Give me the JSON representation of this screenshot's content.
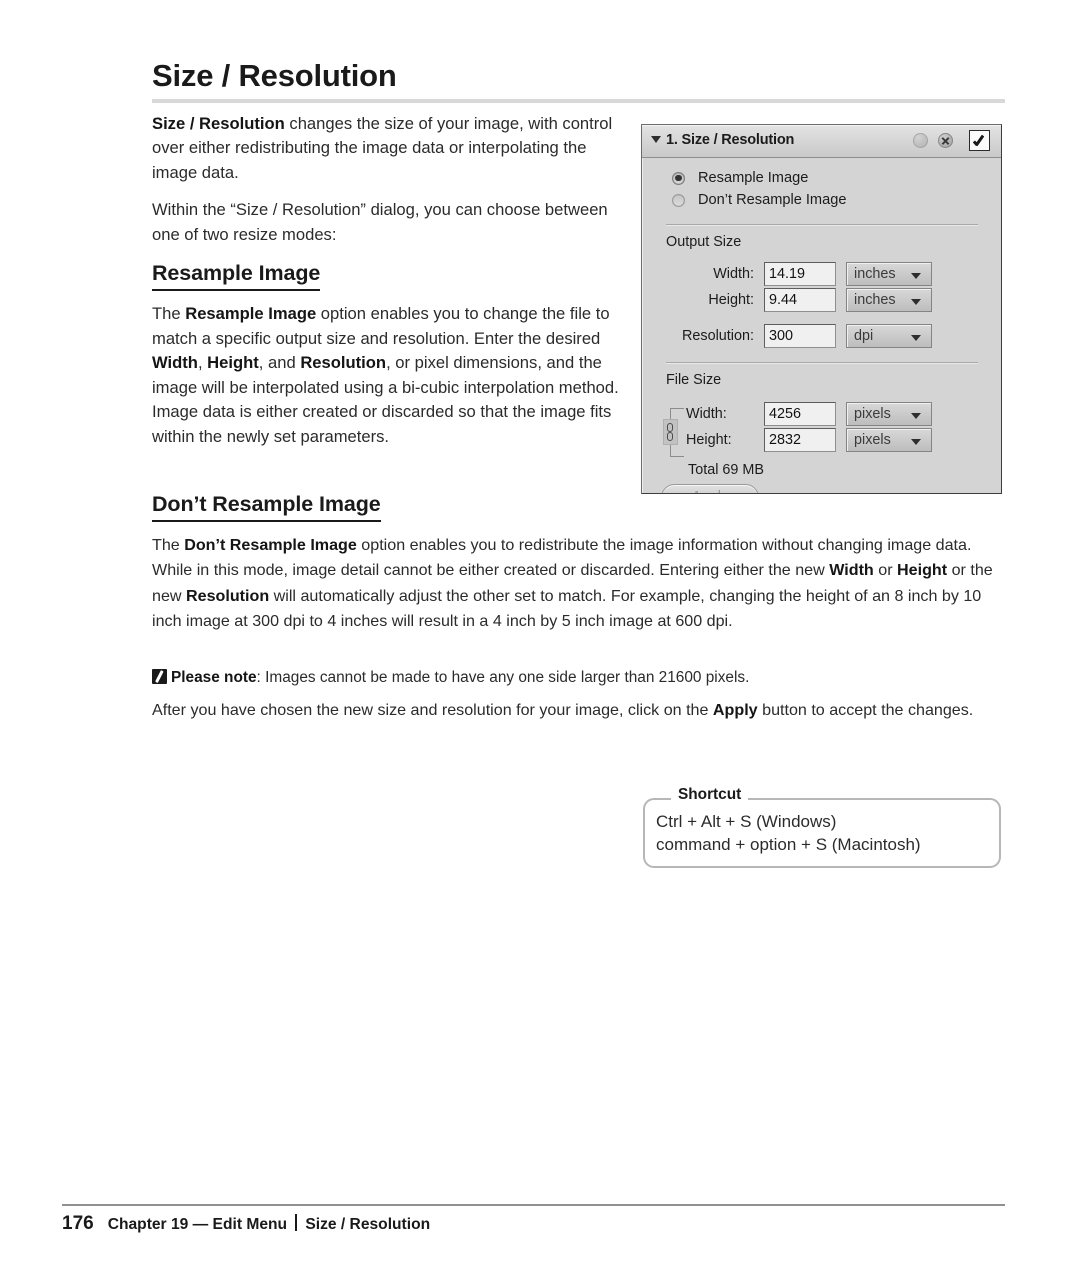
{
  "page": {
    "title": "Size / Resolution"
  },
  "intro": {
    "p1_bold": "Size / Resolution",
    "p1_rest": " changes the size of your image, with control over either redistributing the image data or interpolating the image data.",
    "p2": "Within the “Size / Resolution” dialog, you can choose between one of two resize modes:"
  },
  "resample": {
    "heading": "Resample Image",
    "p_lead": "The ",
    "p_b1": "Resample Image",
    "p_seg1": " option enables you to change the file to match a specific output size and resolution. Enter the desired ",
    "p_b2": "Width",
    "p_seg2": ", ",
    "p_b3": "Height",
    "p_seg3": ", and ",
    "p_b4": "Resolution",
    "p_seg4": ", or pixel dimensions, and the image will be interpolated using a bi-cubic interpolation method. Image data is either created or discarded so that the image fits within the newly set parameters."
  },
  "dont_resample": {
    "heading": "Don’t Resample Image",
    "p_lead": "The ",
    "p_b1": "Don’t Resample Image",
    "p_seg1": " option enables you to redistribute the image information without changing image data. While in this mode, image detail cannot be either created or discarded. Entering either the new ",
    "p_b2": "Width",
    "p_seg2": " or ",
    "p_b3": "Height",
    "p_seg3": " or the new ",
    "p_b4": "Resolution",
    "p_seg4": " will automatically adjust the other set to match. For example, changing the height of an 8 inch by 10 inch image at 300 dpi to 4 inches will result in a 4 inch by 5 inch image at 600 dpi."
  },
  "note": {
    "label": "Please note",
    "text": ": Images cannot be made to have any one side larger than 21600 pixels."
  },
  "after_note": {
    "lead": "After you have chosen the new size and resolution for your image, click on the ",
    "bold": "Apply",
    "tail": " button to accept the changes."
  },
  "shortcut": {
    "legend": "Shortcut",
    "windows": "Ctrl + Alt + S (Windows)",
    "macintosh": "command + option + S (Macintosh)"
  },
  "footer": {
    "page_number": "176",
    "chapter": "Chapter 19 — Edit Menu",
    "section": "Size / Resolution"
  },
  "dialog": {
    "title": "1. Size / Resolution",
    "icons": {
      "disclosure": "triangle-down-icon",
      "help": "help-circle-icon",
      "close": "close-circle-icon",
      "enable": "checkbox-checked-icon"
    },
    "radios": [
      {
        "label": "Resample Image",
        "checked": true
      },
      {
        "label": "Don’t Resample Image",
        "checked": false
      }
    ],
    "output_size": {
      "group_label": "Output Size",
      "fields": [
        {
          "label": "Width:",
          "value": "14.19",
          "unit": "inches"
        },
        {
          "label": "Height:",
          "value": "9.44",
          "unit": "inches"
        },
        {
          "label": "Resolution:",
          "value": "300",
          "unit": "dpi"
        }
      ]
    },
    "file_size": {
      "group_label": "File Size",
      "fields": [
        {
          "label": "Width:",
          "value": "4256",
          "unit": "pixels"
        },
        {
          "label": "Height:",
          "value": "2832",
          "unit": "pixels"
        }
      ],
      "total": "Total 69 MB"
    },
    "apply_label": "Apply"
  },
  "colors": {
    "page_background": "#ffffff",
    "text": "#2b2b2b",
    "heading": "#1a1a1a",
    "rule": "#d8d8d8",
    "dialog_background": "#d4d4d4",
    "dialog_border": "#6b6b6b",
    "shortcut_border": "#b7b7b7",
    "footer_rule": "#909090"
  }
}
